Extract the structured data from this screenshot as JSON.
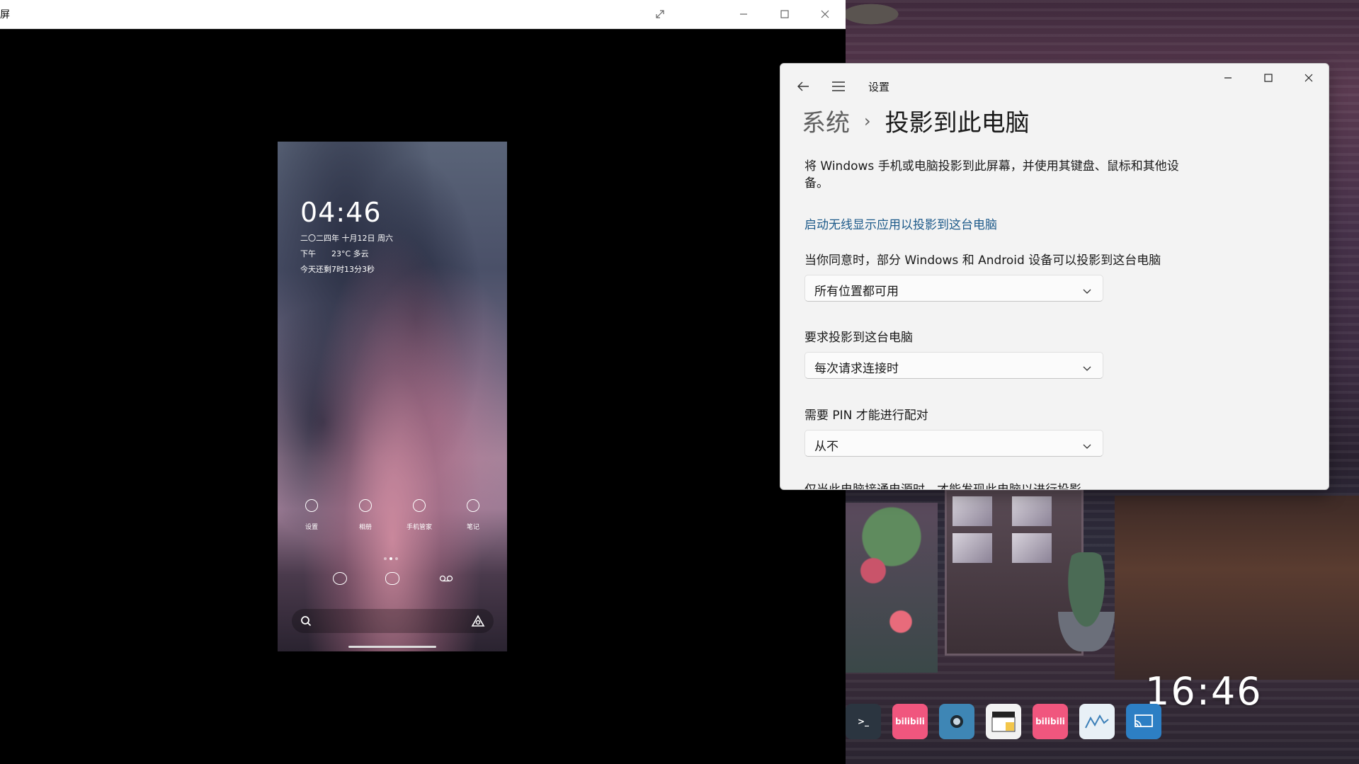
{
  "mirror_window": {
    "title": "屏",
    "controls": {
      "expand_icon": "expand-icon",
      "minimize_icon": "minimize-icon",
      "maximize_icon": "maximize-icon",
      "close_icon": "close-icon"
    }
  },
  "phone": {
    "time": "04:46",
    "date": "二〇二四年 十月12日 周六",
    "period": "下午",
    "weather": "23°C 多云",
    "countdown": "今天还剩7时13分3秒",
    "apps": [
      {
        "label": "设置",
        "icon": "settings-icon"
      },
      {
        "label": "相册",
        "icon": "gallery-icon"
      },
      {
        "label": "手机管家",
        "icon": "phone-manager-icon"
      },
      {
        "label": "笔记",
        "icon": "notes-icon"
      }
    ],
    "dock": [
      "camera-icon",
      "message-icon",
      "recorder-icon"
    ],
    "search_icon": "search-icon",
    "assistant_icon": "assistant-icon"
  },
  "settings": {
    "title": "设置",
    "breadcrumb_parent": "系统",
    "breadcrumb_current": "投影到此电脑",
    "description": "将 Windows 手机或电脑投影到此屏幕，并使用其键盘、鼠标和其他设备。",
    "link": "启动无线显示应用以投影到这台电脑",
    "options": [
      {
        "label": "当你同意时，部分 Windows 和 Android 设备可以投影到这台电脑",
        "value": "所有位置都可用"
      },
      {
        "label": "要求投影到这台电脑",
        "value": "每次请求连接时"
      },
      {
        "label": "需要 PIN 才能进行配对",
        "value": "从不"
      }
    ],
    "partial_text": "仅当此电脑接通电源时，才能发现此电脑以进行投影"
  },
  "desktop": {
    "clock": "16:46",
    "taskbar": [
      {
        "name": "terminal-icon",
        "text": ">_",
        "color": "#2b3540"
      },
      {
        "name": "bilibili-icon",
        "text": "bilibili",
        "color": "#f0567e"
      },
      {
        "name": "obs-icon",
        "text": "",
        "color": "#3e86b5"
      },
      {
        "name": "calendar-icon",
        "text": "",
        "color": "#f2f2f2"
      },
      {
        "name": "bilibili-icon",
        "text": "bilibili",
        "color": "#f0567e"
      },
      {
        "name": "monitor-icon",
        "text": "",
        "color": "#e8f0f6"
      },
      {
        "name": "cast-icon",
        "text": "",
        "color": "#2d7fc4"
      }
    ]
  }
}
